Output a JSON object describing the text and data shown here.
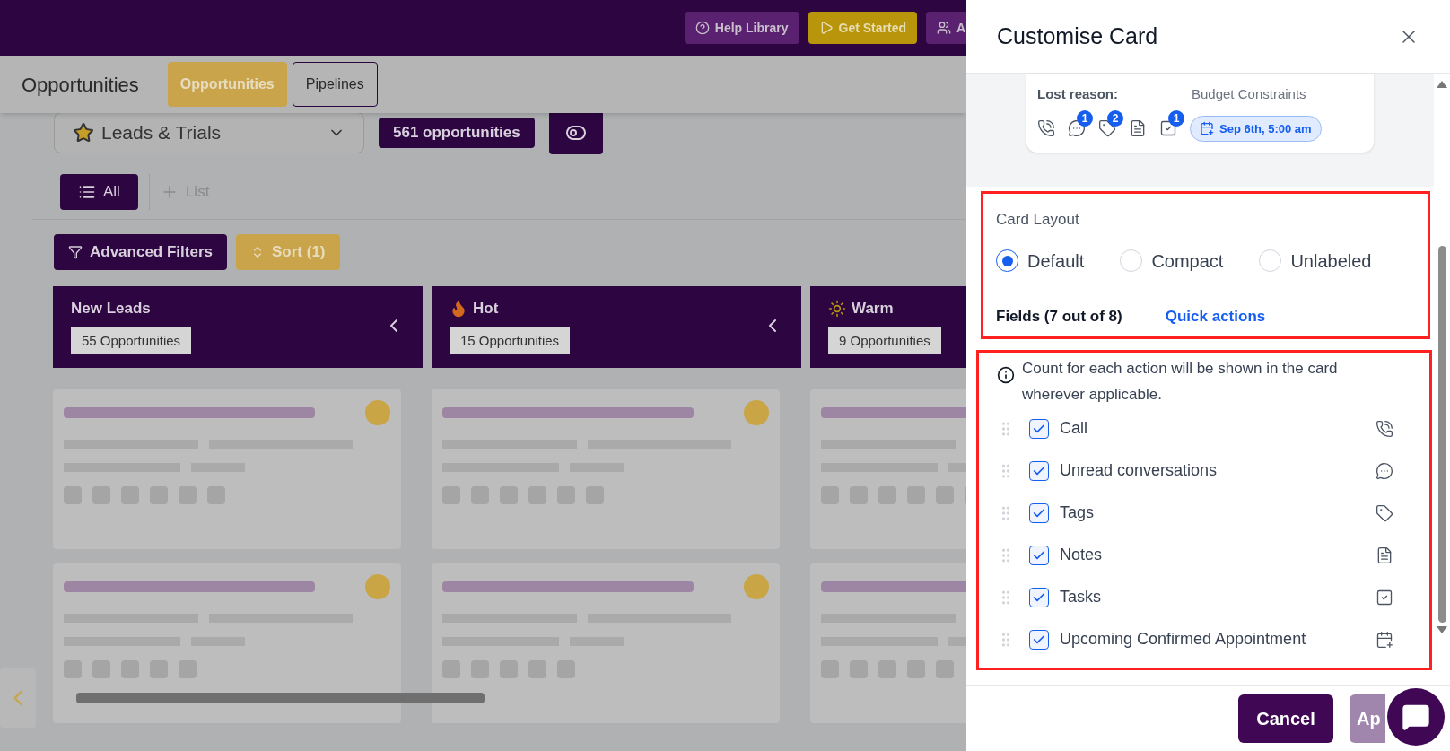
{
  "top_bar": {
    "buttons": [
      {
        "label": "Help Library",
        "kind": "help"
      },
      {
        "label": "Get Started",
        "kind": "start"
      },
      {
        "label": "A",
        "kind": "team"
      }
    ]
  },
  "header": {
    "title": "Opportunities",
    "tabs": [
      {
        "label": "Opportunities",
        "selected": true
      },
      {
        "label": "Pipelines",
        "selected": false
      }
    ]
  },
  "pipeline_select": {
    "value": "Leads & Trials"
  },
  "count_badge": "561 opportunities",
  "list_tabs": [
    {
      "label": "All",
      "selected": true
    }
  ],
  "add_list": "List",
  "filters": {
    "advanced": "Advanced Filters",
    "sort": "Sort (1)"
  },
  "columns": [
    {
      "name": "New Leads",
      "count": "55 Opportunities",
      "kind": "plain"
    },
    {
      "name": "Hot",
      "count": "15 Opportunities",
      "kind": "hot"
    },
    {
      "name": "Warm",
      "count": "9 Opportunities",
      "kind": "warm"
    }
  ],
  "panel": {
    "title": "Customise Card",
    "preview": {
      "label": "Lost reason:",
      "value": "Budget Constraints",
      "actions": [
        {
          "kind": "call"
        },
        {
          "kind": "chat",
          "count": "1"
        },
        {
          "kind": "tag",
          "count": "2"
        },
        {
          "kind": "note"
        },
        {
          "kind": "task",
          "count": "1"
        }
      ],
      "appointment": "Sep 6th, 5:00 am"
    },
    "layout": {
      "label": "Card Layout",
      "options": [
        {
          "label": "Default",
          "selected": true
        },
        {
          "label": "Compact",
          "selected": false
        },
        {
          "label": "Unlabeled",
          "selected": false
        }
      ]
    },
    "sections": [
      {
        "label": "Fields (7 out of 8)",
        "selected": false
      },
      {
        "label": "Quick actions",
        "selected": true
      }
    ],
    "info": "Count for each action will be shown in the card wherever applicable.",
    "actions": [
      {
        "label": "Call",
        "checked": true,
        "kind": "call"
      },
      {
        "label": "Unread conversations",
        "checked": true,
        "kind": "chat"
      },
      {
        "label": "Tags",
        "checked": true,
        "kind": "tag"
      },
      {
        "label": "Notes",
        "checked": true,
        "kind": "note"
      },
      {
        "label": "Tasks",
        "checked": true,
        "kind": "task"
      },
      {
        "label": "Upcoming Confirmed Appointment",
        "checked": true,
        "kind": "appointment"
      }
    ],
    "cancel": "Cancel",
    "apply": {
      "label": "Ap",
      "disabled": true
    }
  }
}
